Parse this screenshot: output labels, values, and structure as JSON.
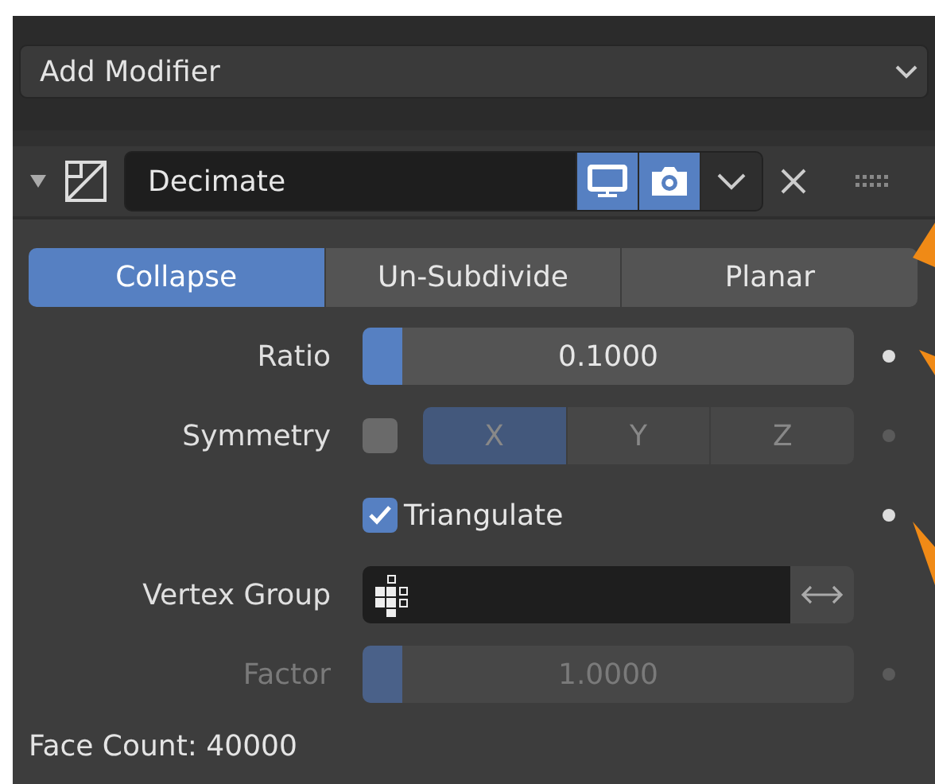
{
  "add_modifier": {
    "label": "Add Modifier"
  },
  "modifier": {
    "expanded": true,
    "name": "Decimate",
    "show_viewport": true,
    "show_render": true
  },
  "modes": [
    {
      "label": "Collapse",
      "selected": true
    },
    {
      "label": "Un-Subdivide",
      "selected": false
    },
    {
      "label": "Planar",
      "selected": false
    }
  ],
  "ratio": {
    "label": "Ratio",
    "value": "0.1000",
    "level": 0.08
  },
  "symmetry": {
    "label": "Symmetry",
    "checked": false,
    "axes": [
      {
        "label": "X",
        "selected": true
      },
      {
        "label": "Y",
        "selected": false
      },
      {
        "label": "Z",
        "selected": false
      }
    ]
  },
  "triangulate": {
    "label": "Triangulate",
    "checked": true
  },
  "vertex_group": {
    "label": "Vertex Group"
  },
  "factor": {
    "label": "Factor",
    "value": "1.0000",
    "level": 0.08,
    "disabled": true
  },
  "face_count": "Face Count: 40000"
}
